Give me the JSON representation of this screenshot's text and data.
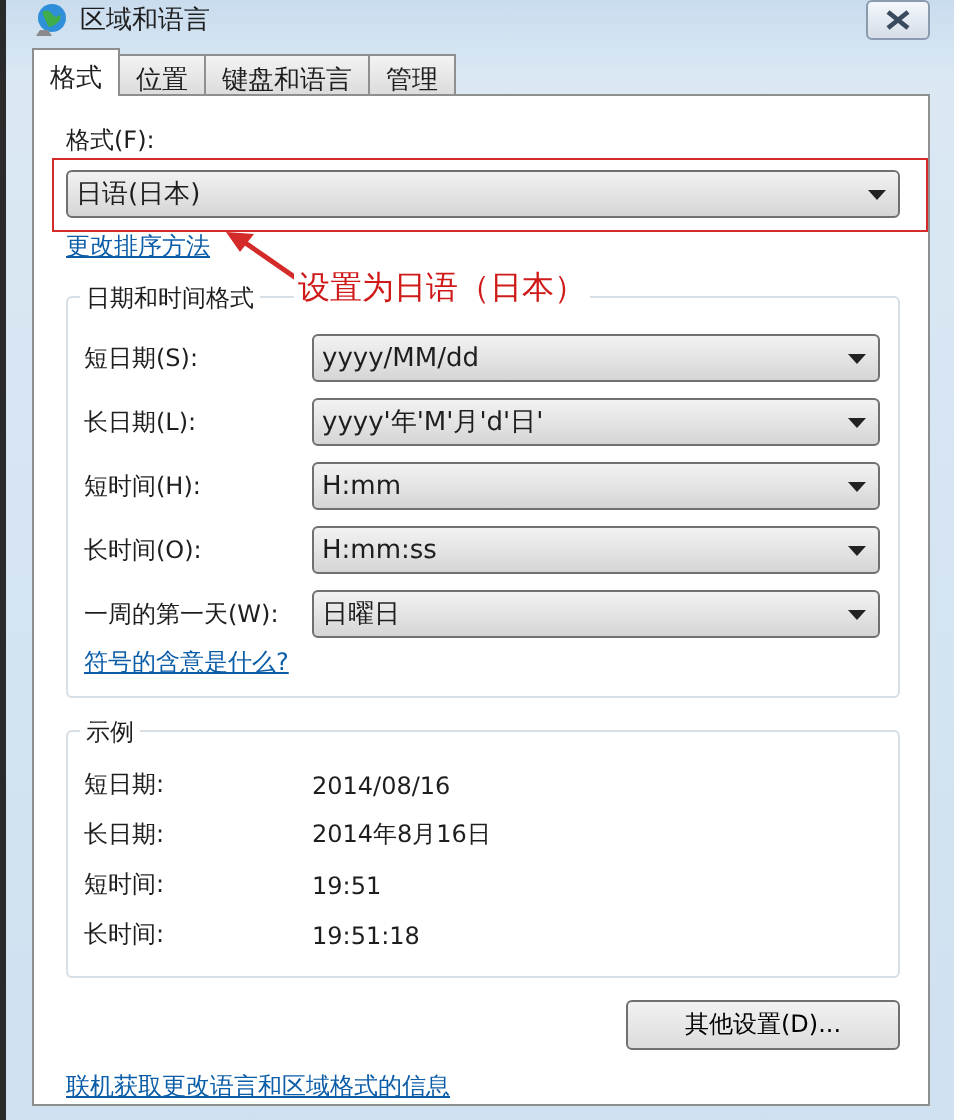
{
  "window": {
    "title": "区域和语言"
  },
  "tabs": [
    {
      "label": "格式",
      "selected": true
    },
    {
      "label": "位置",
      "selected": false
    },
    {
      "label": "键盘和语言",
      "selected": false
    },
    {
      "label": "管理",
      "selected": false
    }
  ],
  "format": {
    "label": "格式(F):",
    "value": "日语(日本)",
    "link": "更改排序方法"
  },
  "annotation": {
    "text": "设置为日语（日本）"
  },
  "datetime_group": {
    "title": "日期和时间格式",
    "rows": [
      {
        "label": "短日期(S):",
        "value": "yyyy/MM/dd"
      },
      {
        "label": "长日期(L):",
        "value": "yyyy'年'M'月'd'日'"
      },
      {
        "label": "短时间(H):",
        "value": "H:mm"
      },
      {
        "label": "长时间(O):",
        "value": "H:mm:ss"
      },
      {
        "label": "一周的第一天(W):",
        "value": "日曜日"
      }
    ],
    "link": "符号的含意是什么?"
  },
  "example_group": {
    "title": "示例",
    "rows": [
      {
        "label": "短日期:",
        "value": "2014/08/16"
      },
      {
        "label": "长日期:",
        "value": "2014年8月16日"
      },
      {
        "label": "短时间:",
        "value": "19:51"
      },
      {
        "label": "长时间:",
        "value": "19:51:18"
      }
    ]
  },
  "buttons": [
    "其他设置(D)..."
  ],
  "footer_link": "联机获取更改语言和区域格式的信息"
}
